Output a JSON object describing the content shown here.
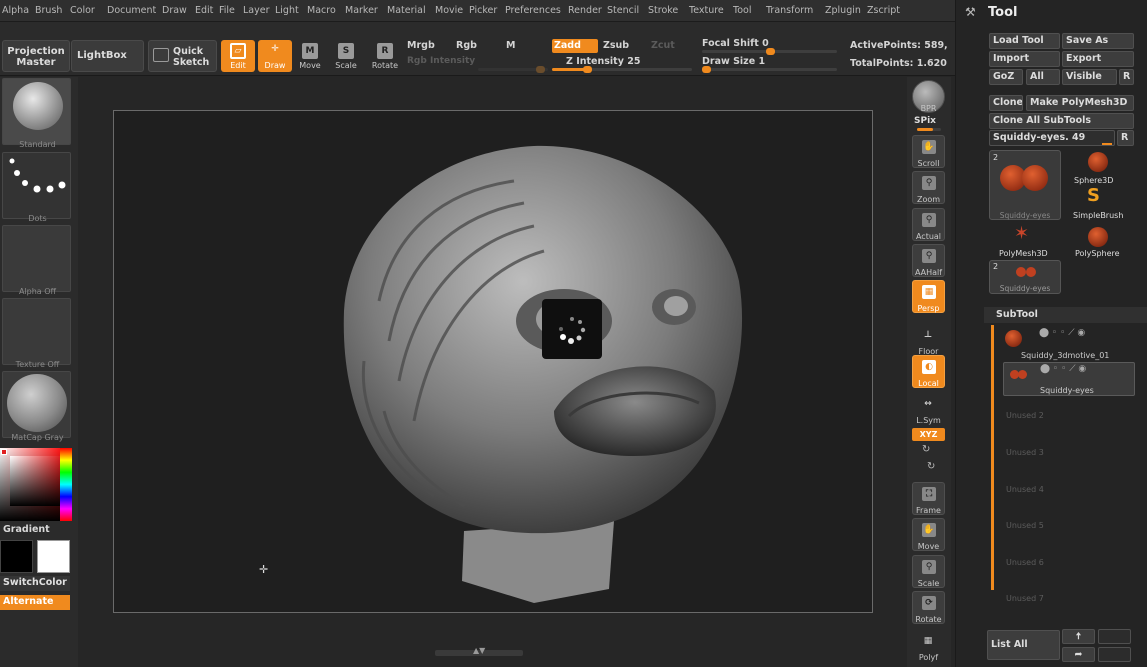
{
  "menu": [
    "Alpha",
    "Brush",
    "Color",
    "Document",
    "Draw",
    "Edit",
    "File",
    "Layer",
    "Light",
    "Macro",
    "Marker",
    "Material",
    "Movie",
    "Picker",
    "Preferences",
    "Render",
    "Stencil",
    "Stroke",
    "Texture",
    "Tool",
    "Transform",
    "Zplugin",
    "Zscript"
  ],
  "toolbar": {
    "projection_master": "Projection Master",
    "lightbox": "LightBox",
    "quick_sketch": "Quick Sketch",
    "edit": "Edit",
    "draw": "Draw",
    "move": "Move",
    "scale": "Scale",
    "rotate": "Rotate",
    "mrgb": "Mrgb",
    "rgb": "Rgb",
    "m": "M",
    "rgb_intensity": "Rgb Intensity",
    "zadd": "Zadd",
    "zsub": "Zsub",
    "zcut": "Zcut",
    "z_intensity_label": "Z Intensity",
    "z_intensity_value": "25",
    "focal_shift_label": "Focal Shift",
    "focal_shift_value": "0",
    "draw_size_label": "Draw Size",
    "draw_size_value": "1",
    "active_points": "ActivePoints: 589,",
    "total_points": "TotalPoints: 1.620",
    "z_intensity_fraction": 0.25
  },
  "left_shelf": {
    "standard": "Standard",
    "dots": "Dots",
    "alpha_off": "Alpha Off",
    "texture_off": "Texture Off",
    "matcap_gray": "MatCap Gray",
    "gradient": "Gradient",
    "switch_color": "SwitchColor",
    "alternate": "Alternate"
  },
  "right_shelf": {
    "bpr": "BPR",
    "spix": "SPix",
    "scroll": "Scroll",
    "zoom": "Zoom",
    "actual": "Actual",
    "aahalf": "AAHalf",
    "persp": "Persp",
    "floor": "Floor",
    "local": "Local",
    "lsym": "L.Sym",
    "xyz": "XYZ",
    "frame": "Frame",
    "move": "Move",
    "scale": "Scale",
    "rotate": "Rotate",
    "polyf": "Polyf"
  },
  "tool_panel": {
    "title": "Tool",
    "load_tool": "Load Tool",
    "save_as": "Save As",
    "import": "Import",
    "export": "Export",
    "goz": "GoZ",
    "all": "All",
    "visible": "Visible",
    "r": "R",
    "clone": "Clone",
    "make_polymesh": "Make PolyMesh3D",
    "clone_all": "Clone All SubTools",
    "current_tool": "Squiddy-eyes. 49",
    "tools": [
      {
        "name": "Squiddy-eyes",
        "count": "2"
      },
      {
        "name": "Sphere3D"
      },
      {
        "name": "SimpleBrush"
      },
      {
        "name": "PolyMesh3D"
      },
      {
        "name": "PolySphere"
      },
      {
        "name": "Squiddy-eyes",
        "count": "2"
      }
    ],
    "subtool_title": "SubTool",
    "subtools": [
      "Squiddy_3dmotive_01",
      "Squiddy-eyes"
    ],
    "unused": [
      "Unused 2",
      "Unused 3",
      "Unused 4",
      "Unused 5",
      "Unused 6",
      "Unused 7"
    ],
    "list_all": "List All"
  },
  "colors": {
    "accent": "#f08a1e",
    "panel": "#2b2b2b",
    "canvas": "#1f1f1f"
  }
}
